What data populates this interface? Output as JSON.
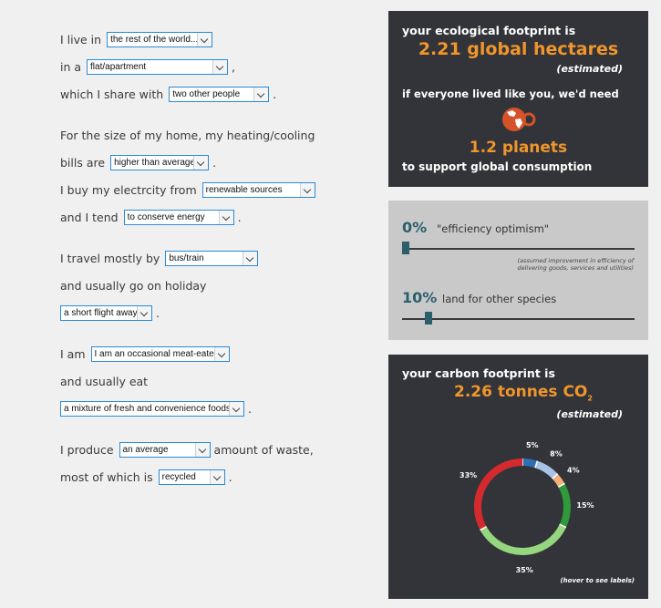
{
  "form": {
    "live_in_label": "I live in",
    "live_in_value": "the rest of the world...",
    "in_a_label": "in a",
    "home_type_value": "flat/apartment",
    "comma": ",",
    "share_label": "which I share with",
    "share_value": "two other people",
    "period": ".",
    "heating_label_1": "For the size of my home, my heating/cooling",
    "bills_label": "bills are",
    "bills_value": "higher than average",
    "electricity_label": "I buy my electrcity from",
    "electricity_value": "renewable sources",
    "tend_label": "and I tend",
    "tend_value": "to conserve energy",
    "travel_label": "I travel mostly by",
    "travel_value": "bus/train",
    "holiday_label": "and usually go on holiday",
    "holiday_value": "a short flight away",
    "iam_label": "I am",
    "diet_value": "I am an occasional meat-eater",
    "eat_label": "and usually eat",
    "eat_value": "a mixture of fresh and convenience foods",
    "produce_label": "I produce",
    "waste_value": "an average",
    "waste_suffix": "amount of waste,",
    "recycle_label": "most of which is",
    "recycle_value": "recycled"
  },
  "eco": {
    "heading": "your ecological footprint is",
    "value": "2.21 global hectares",
    "estimated": "(estimated)",
    "everyone": "if everyone lived like you, we'd need",
    "planets": "1.2 planets",
    "support": "to support global consumption"
  },
  "sliders": {
    "efficiency_value": "0%",
    "efficiency_label": "\"efficiency optimism\"",
    "efficiency_note_1": "(assumed improvement in efficiency of",
    "efficiency_note_2": "delivering goods, services and utilities)",
    "efficiency_level": 0,
    "land_value": "10%",
    "land_label": "land for other species",
    "land_level": 10
  },
  "carbon": {
    "heading": "your carbon footprint is",
    "value": "2.26 tonnes CO",
    "value_sub": "2",
    "estimated": "(estimated)",
    "hover": "(hover to see labels)"
  },
  "chart_data": {
    "type": "pie",
    "donut": true,
    "labels": [
      "5%",
      "8%",
      "4%",
      "15%",
      "35%",
      "33%"
    ],
    "values": [
      5,
      8,
      4,
      15,
      35,
      33
    ],
    "colors": [
      "#2e6fb5",
      "#a9c3e6",
      "#f4b07a",
      "#2e9a3a",
      "#95d67f",
      "#d42a2e"
    ]
  },
  "colors": {
    "accent": "#f0962b",
    "panel": "#333439",
    "slider": "#2b5f6b"
  }
}
